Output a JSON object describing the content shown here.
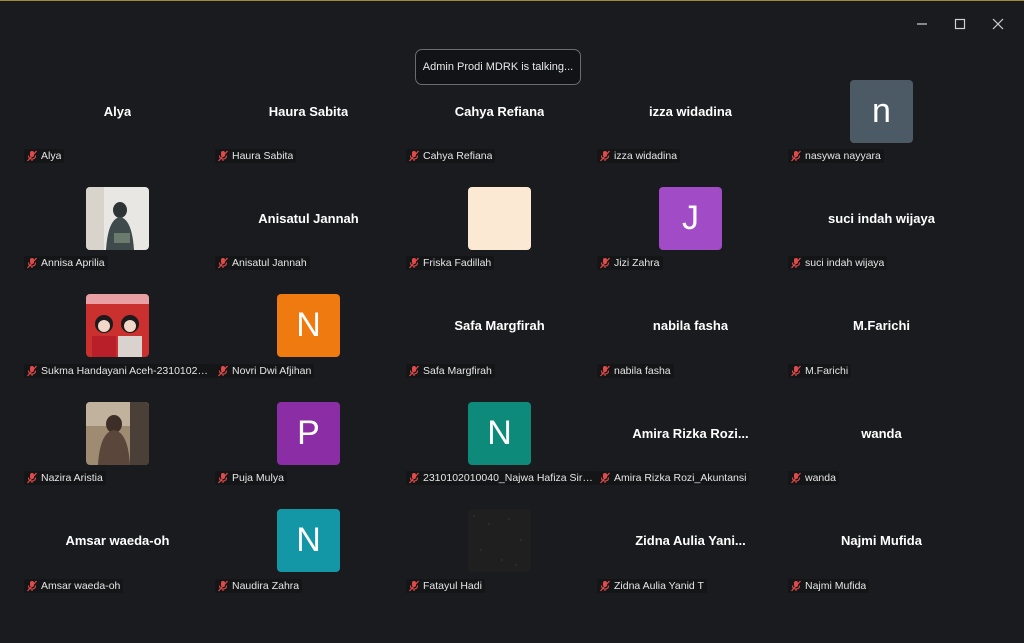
{
  "window": {
    "minimize": "—",
    "maximize": "☐",
    "close": "✕"
  },
  "banner": {
    "text": "Admin Prodi MDRK is talking..."
  },
  "colors": {
    "mic_muted": "#e04a4a"
  },
  "participants": [
    {
      "label": "Alya",
      "display": "Alya",
      "kind": "name"
    },
    {
      "label": "Haura Sabita",
      "display": "Haura Sabita",
      "kind": "name"
    },
    {
      "label": "Cahya Refiana",
      "display": "Cahya Refiana",
      "kind": "name"
    },
    {
      "label": "izza widadina",
      "display": "izza widadina",
      "kind": "name"
    },
    {
      "label": "nasywa nayyara",
      "initial": "n",
      "color": "#4c5a66",
      "kind": "avatar"
    },
    {
      "label": "Annisa Aprilia",
      "kind": "photo",
      "photo": "seated"
    },
    {
      "label": "Anisatul Jannah",
      "display": "Anisatul Jannah",
      "kind": "name"
    },
    {
      "label": "Friska Fadillah",
      "kind": "photo",
      "photo": "cream"
    },
    {
      "label": "Jizi Zahra",
      "initial": "J",
      "color": "#a24bc6",
      "kind": "avatar"
    },
    {
      "label": "suci indah wijaya",
      "display": "suci indah wijaya",
      "kind": "name"
    },
    {
      "label": "Sukma Handayani Aceh-231010201...",
      "kind": "photo",
      "photo": "pair"
    },
    {
      "label": "Novri Dwi Afjihan",
      "initial": "N",
      "color": "#ef7a10",
      "kind": "avatar"
    },
    {
      "label": "Safa Margfirah",
      "display": "Safa Margfirah",
      "kind": "name"
    },
    {
      "label": "nabila fasha",
      "display": "nabila fasha",
      "kind": "name"
    },
    {
      "label": "M.Farichi",
      "display": "M.Farichi",
      "kind": "name"
    },
    {
      "label": "Nazira Aristia",
      "kind": "photo",
      "photo": "veil"
    },
    {
      "label": "Puja Mulya",
      "initial": "P",
      "color": "#8b2ea6",
      "kind": "avatar"
    },
    {
      "label": "2310102010040_Najwa Hafiza Sireg...",
      "initial": "N",
      "color": "#0e8a7a",
      "kind": "avatar"
    },
    {
      "label": "Amira Rizka Rozi_Akuntansi",
      "display": "Amira  Rizka  Rozi...",
      "kind": "name"
    },
    {
      "label": "wanda",
      "display": "wanda",
      "kind": "name"
    },
    {
      "label": "Amsar waeda-oh",
      "display": "Amsar waeda-oh",
      "kind": "name"
    },
    {
      "label": "Naudira Zahra",
      "initial": "N",
      "color": "#1397a6",
      "kind": "avatar"
    },
    {
      "label": "Fatayul Hadi",
      "kind": "photo",
      "photo": "dark"
    },
    {
      "label": "Zidna Aulia Yanid T",
      "display": "Zidna  Aulia  Yani...",
      "kind": "name"
    },
    {
      "label": "Najmi Mufida",
      "display": "Najmi Mufida",
      "kind": "name"
    }
  ]
}
